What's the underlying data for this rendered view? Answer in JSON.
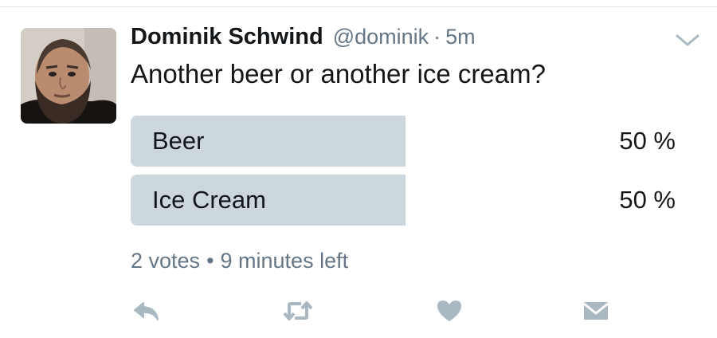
{
  "tweet": {
    "author_name": "Dominik Schwind",
    "author_handle": "@dominik",
    "separator": "·",
    "timestamp": "5m",
    "text": "Another beer or another ice cream?"
  },
  "poll": {
    "options": [
      {
        "label": "Beer",
        "percent_text": "50 %",
        "share": 0.5
      },
      {
        "label": "Ice Cream",
        "percent_text": "50 %",
        "share": 0.5
      }
    ],
    "votes": "2 votes",
    "dot": "•",
    "time_left": "9 minutes left"
  },
  "icons": {
    "menu": "chevron-down-icon",
    "reply": "reply-icon",
    "retweet": "retweet-icon",
    "like": "heart-icon",
    "message": "envelope-icon"
  },
  "colors": {
    "icon_gray": "#aab8c2",
    "meta_gray": "#657786",
    "poll_bar": "#ccd6dd"
  }
}
